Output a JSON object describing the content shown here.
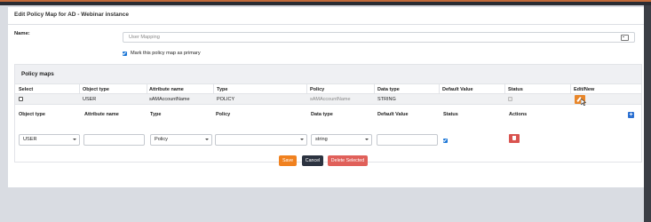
{
  "dialog": {
    "title": "Edit Policy Map for AD - Webinar instance"
  },
  "name_field": {
    "label": "Name:",
    "value": "User Mapping",
    "icon": "id-card-icon"
  },
  "primary": {
    "label": "Mark this policy map as primary",
    "checked": true
  },
  "policy_maps": {
    "title": "Policy maps",
    "columns": [
      "Select",
      "Object type",
      "Attribute name",
      "Type",
      "Policy",
      "Data type",
      "Default Value",
      "Status",
      "Edit/New"
    ],
    "rows": [
      {
        "object_type": "USER",
        "attribute_name": "sAMAccountName",
        "type": "POLICY",
        "policy": "sAMAccountName",
        "data_type": "STRING",
        "default_value": "",
        "status_checked": true,
        "selected": false
      }
    ]
  },
  "new_entry": {
    "columns": [
      "Object type",
      "Attribute name",
      "Type",
      "Policy",
      "Data type",
      "Default Value",
      "Status",
      "Actions"
    ],
    "object_type": "USER",
    "attribute_name": "",
    "type": "Policy",
    "policy": "",
    "data_type": "string",
    "default_value": "",
    "status_checked": true
  },
  "buttons": {
    "save": "Save",
    "cancel": "Cancel",
    "delete": "Delete Selected"
  },
  "colors": {
    "primary": "#f0811f",
    "dark": "#2c3340",
    "danger": "#e0605a",
    "accent_blue": "#1e78d7"
  }
}
